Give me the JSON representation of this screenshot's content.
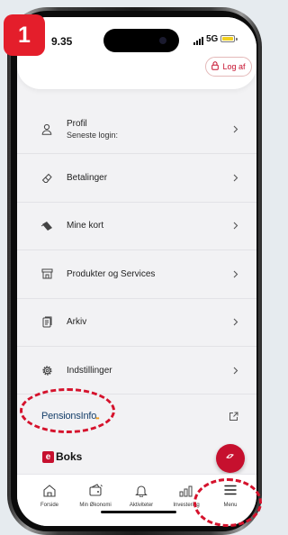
{
  "status_bar": {
    "time": "9.35",
    "network": "5G"
  },
  "header": {
    "logout_label": "Log af"
  },
  "menu": {
    "items": [
      {
        "title": "Profil",
        "subtitle": "Seneste login:",
        "icon": "person-icon"
      },
      {
        "title": "Betalinger",
        "icon": "eraser-icon"
      },
      {
        "title": "Mine kort",
        "icon": "card-icon"
      },
      {
        "title": "Produkter og Services",
        "icon": "store-icon"
      },
      {
        "title": "Arkiv",
        "icon": "archive-icon"
      },
      {
        "title": "Indstillinger",
        "icon": "gear-icon"
      }
    ]
  },
  "pensions": {
    "logo_text": "PensionsInfo",
    "logo_dots": "••"
  },
  "eboks": {
    "logo_letter": "e",
    "logo_text": "Boks"
  },
  "tabs": [
    {
      "label": "Forside",
      "icon": "home-icon"
    },
    {
      "label": "Min Økonomi",
      "icon": "wallet-icon"
    },
    {
      "label": "Aktiviteter",
      "icon": "bell-icon"
    },
    {
      "label": "Investering",
      "icon": "chart-icon"
    },
    {
      "label": "Menu",
      "icon": "hamburger-icon"
    }
  ],
  "annotation": {
    "step_number": "1"
  },
  "colors": {
    "brand_red": "#c6102e",
    "annotation_red": "#d5122c",
    "pensions_blue": "#17406b"
  }
}
